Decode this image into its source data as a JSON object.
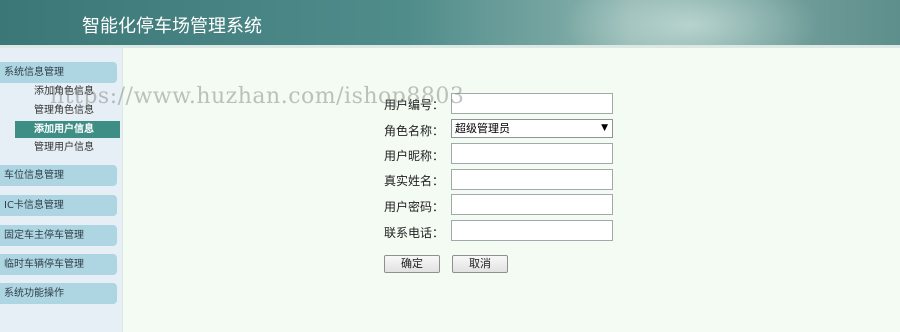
{
  "header": {
    "title": "智能化停车场管理系统"
  },
  "sidebar": {
    "groups": [
      {
        "label": "系统信息管理",
        "items": [
          "添加角色信息",
          "管理角色信息",
          "添加用户信息",
          "管理用户信息"
        ]
      },
      {
        "label": "车位信息管理"
      },
      {
        "label": "IC卡信息管理"
      },
      {
        "label": "固定车主停车管理"
      },
      {
        "label": "临时车辆停车管理"
      },
      {
        "label": "系统功能操作"
      }
    ],
    "active_item": "添加用户信息"
  },
  "form": {
    "user_id": {
      "label": "用户编号：",
      "value": ""
    },
    "role": {
      "label": "角色名称：",
      "value": "超级管理员"
    },
    "nickname": {
      "label": "用户昵称：",
      "value": ""
    },
    "real_name": {
      "label": "真实姓名：",
      "value": ""
    },
    "password": {
      "label": "用户密码：",
      "value": ""
    },
    "phone": {
      "label": "联系电话：",
      "value": ""
    },
    "confirm_label": "确定",
    "cancel_label": "取消"
  },
  "watermark": "https://www.huzhan.com/ishop8803",
  "colors": {
    "header_bg": "#4f8c8a",
    "menu_group_bg": "#aed6e2",
    "active_item_bg": "#3e8e86",
    "main_bg": "#f3fbf3",
    "sidebar_bg": "#e6eff5"
  }
}
